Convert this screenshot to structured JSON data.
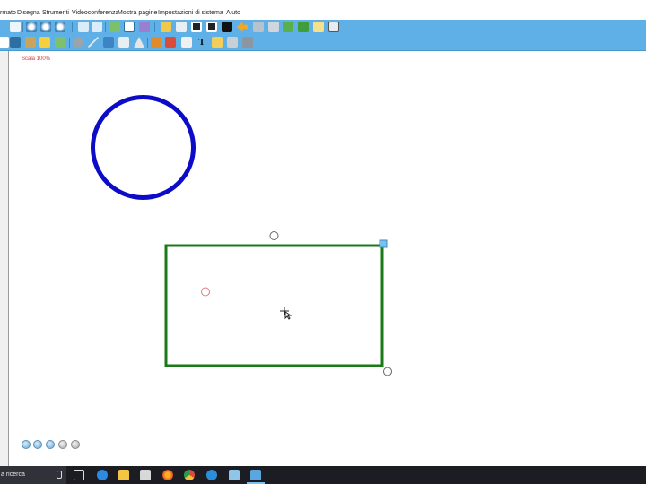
{
  "menu": {
    "items": [
      "rmato",
      "Disegna",
      "Strumenti",
      "Videoconferenza",
      "Mostra pagine",
      "Impostazioni di sistema",
      "Aiuto"
    ]
  },
  "toolbar_row1": {
    "icons": [
      "new-page-icon",
      "zoom-in-icon",
      "zoom-out-icon",
      "zoom-fit-icon",
      "prev-page-icon",
      "next-page-icon",
      "fullscreen-icon",
      "grid-icon",
      "hand-icon",
      "eraser-icon",
      "select-icon",
      "screen-icon",
      "back-icon",
      "trash-icon",
      "print-icon",
      "save-icon",
      "record-icon",
      "window-icon",
      "close-icon"
    ]
  },
  "toolbar_row2": {
    "icons": [
      "pen-icon",
      "pencil-icon",
      "brush-icon",
      "highlighter-icon",
      "magic-pen-icon",
      "shape-icon",
      "line-icon",
      "fill-icon",
      "chart-icon",
      "triangle-icon",
      "stamp-icon",
      "books-icon",
      "keyboard-icon",
      "text-icon",
      "image-icon",
      "ruler-icon",
      "tools-icon"
    ]
  },
  "canvas": {
    "scale_label": "Scala 100%",
    "circle_color": "#0c0cc8",
    "rect_color": "#1a7a1a"
  },
  "page_nav": {
    "icons": [
      "first-page-icon",
      "prev-page-nav-icon",
      "add-page-icon",
      "next-page-nav-icon",
      "last-page-icon"
    ]
  },
  "taskbar": {
    "search_text": "a ricerca",
    "icons": [
      "task-view-icon",
      "edge-icon",
      "explorer-icon",
      "store-icon",
      "firefox-icon",
      "chrome-icon",
      "app-blue-icon",
      "notepad-icon",
      "whiteboard-app-icon"
    ]
  }
}
